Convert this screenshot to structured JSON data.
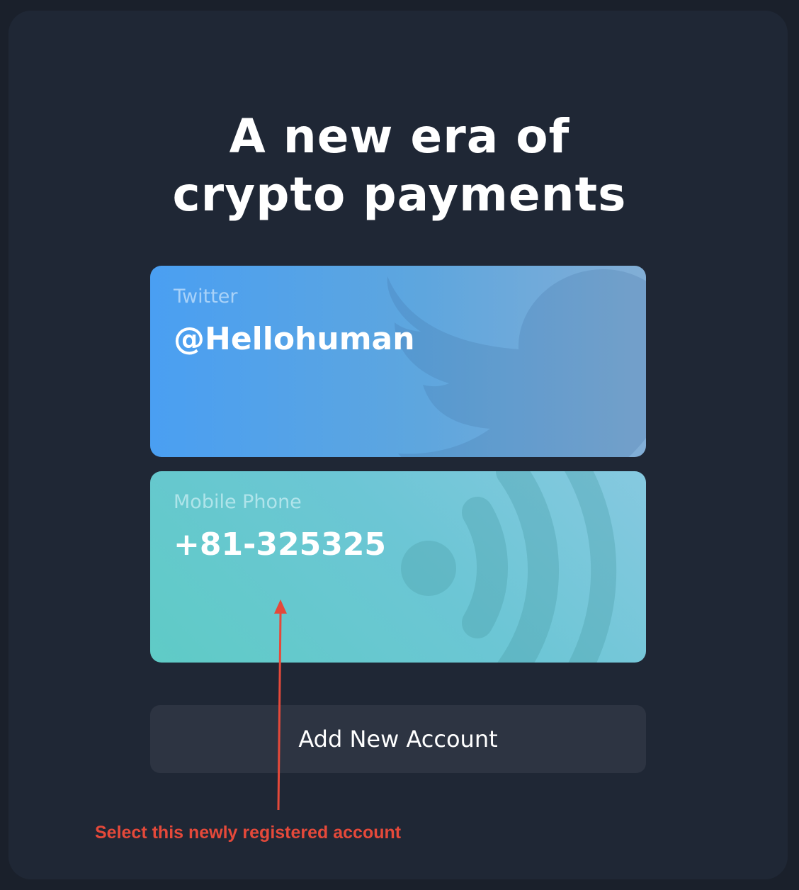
{
  "headline": {
    "line1": "A new era of",
    "line2": "crypto payments"
  },
  "accounts": [
    {
      "label": "Twitter",
      "value": "@Hellohuman",
      "icon": "twitter-bird-icon"
    },
    {
      "label": "Mobile Phone",
      "value": "+81-325325",
      "icon": "wireless-signal-icon"
    }
  ],
  "add_button": {
    "label": "Add New Account"
  },
  "annotation": {
    "text": "Select this newly registered account",
    "color": "#e5493a"
  },
  "colors": {
    "background": "#1a202b",
    "panel": "#1f2735",
    "twitter_card": "#4a9ff2",
    "phone_card": "#5fcbc6",
    "button": "#2d3442"
  }
}
